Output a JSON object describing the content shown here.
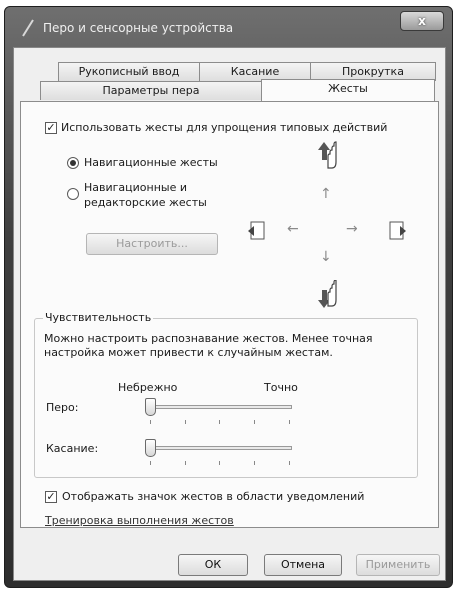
{
  "window": {
    "title": "Перо и сенсорные устройства",
    "close_glyph": "x"
  },
  "tabs": {
    "row1": [
      "Рукописный ввод",
      "Касание",
      "Прокрутка"
    ],
    "row2": [
      "Параметры пера",
      "Жесты"
    ],
    "active": "Жесты"
  },
  "gestures": {
    "enable_checkbox": {
      "label": "Использовать жесты для упрощения типовых действий",
      "checked": true
    },
    "radio_nav": {
      "label": "Навигационные жесты",
      "selected": true
    },
    "radio_nav_edit": {
      "label_line1": "Навигационные и",
      "label_line2": "редакторские жесты",
      "selected": false
    },
    "customize_button": "Настроить...",
    "arrows": {
      "up": "↑",
      "left": "←",
      "right": "→",
      "down": "↓"
    }
  },
  "sensitivity": {
    "group_title": "Чувствительность",
    "description_line1": "Можно настроить распознавание жестов. Менее точная",
    "description_line2": "настройка может привести к случайным жестам.",
    "scale_low": "Небрежно",
    "scale_high": "Точно",
    "pen_label": "Перо:",
    "touch_label": "Касание:",
    "pen_value": 0,
    "touch_value": 0
  },
  "notify_checkbox": {
    "label": "Отображать значок жестов в области уведомлений",
    "checked": true
  },
  "training_link": "Тренировка выполнения жестов",
  "buttons": {
    "ok": "ОК",
    "cancel": "Отмена",
    "apply": "Применить"
  }
}
